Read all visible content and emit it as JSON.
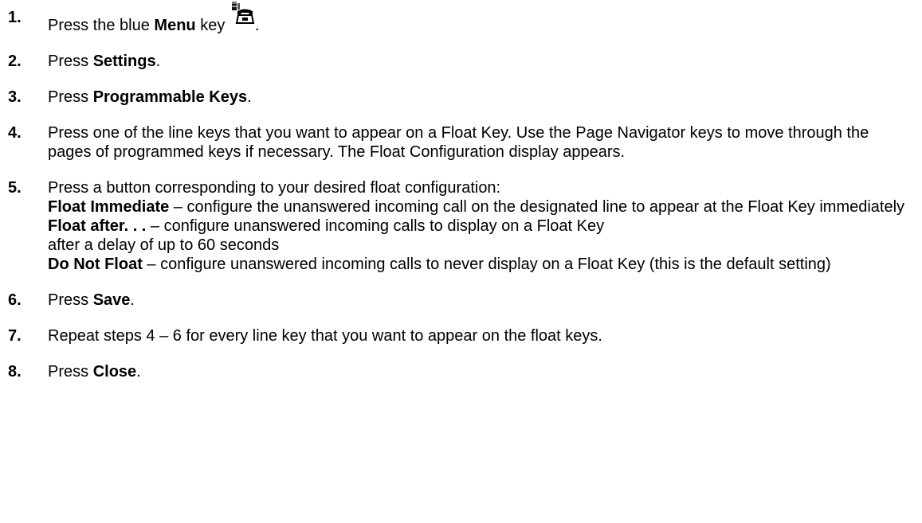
{
  "steps": [
    {
      "num": "1.",
      "pre": "Press the blue ",
      "bold": "Menu",
      "post_icon": " key ",
      "icon": "menu-phone-icon",
      "end": "."
    },
    {
      "num": "2.",
      "pre": "Press ",
      "bold": "Settings",
      "end": "."
    },
    {
      "num": "3.",
      "pre": "Press ",
      "bold": "Programmable Keys",
      "end": "."
    },
    {
      "num": "4.",
      "text": "Press one of the line keys that you want to appear on a Float Key. Use the Page Navigator keys to move through the pages of programmed keys if necessary. The Float Configuration display appears."
    },
    {
      "num": "5.",
      "intro": "Press a button corresponding to your desired float configuration:",
      "options": [
        {
          "bold": "Float Immediate",
          "text": " – configure the unanswered incoming call on the designated line to appear at the Float Key immediately"
        },
        {
          "bold": "Float after. . .",
          "text": " – configure unanswered incoming calls to display on a Float Key",
          "text2": "after a delay of up to 60 seconds"
        },
        {
          "bold": "Do Not Float",
          "text": " – configure unanswered incoming calls to never display on a Float Key (this is the default setting)"
        }
      ]
    },
    {
      "num": "6.",
      "pre": "Press ",
      "bold": "Save",
      "end": "."
    },
    {
      "num": "7.",
      "text": "Repeat steps 4 – 6 for every line key that you want to appear on the float keys."
    },
    {
      "num": "8.",
      "pre": "Press ",
      "bold": "Close",
      "end": "."
    }
  ]
}
